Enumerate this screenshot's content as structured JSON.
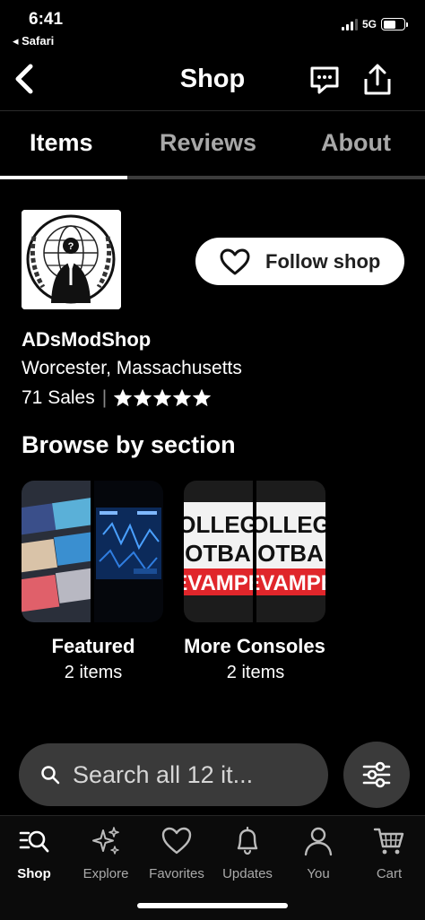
{
  "status_bar": {
    "time": "6:41",
    "back_app": "◂ Safari",
    "network": "5G"
  },
  "header": {
    "title": "Shop",
    "back_icon": "chevron-left-icon",
    "message_icon": "message-icon",
    "share_icon": "share-icon"
  },
  "tabs": [
    {
      "label": "Items",
      "active": true
    },
    {
      "label": "Reviews",
      "active": false
    },
    {
      "label": "About",
      "active": false
    }
  ],
  "shop": {
    "name": "ADsModShop",
    "location": "Worcester, Massachusetts",
    "sales": "71 Sales",
    "rating": 5,
    "follow_label": "Follow shop"
  },
  "browse": {
    "heading": "Browse by section",
    "sections": [
      {
        "name": "Featured",
        "count": "2 items"
      },
      {
        "name": "More Consoles",
        "count": "2 items"
      }
    ],
    "thumb_text": {
      "line1": "OLLEG",
      "line2": "OTBA",
      "line3": "EVAMPE"
    }
  },
  "search": {
    "placeholder": "Search all 12 it..."
  },
  "nav": [
    {
      "label": "Shop",
      "icon": "shop-search-icon",
      "active": true
    },
    {
      "label": "Explore",
      "icon": "sparkle-icon",
      "active": false
    },
    {
      "label": "Favorites",
      "icon": "heart-icon",
      "active": false
    },
    {
      "label": "Updates",
      "icon": "bell-icon",
      "active": false
    },
    {
      "label": "You",
      "icon": "user-icon",
      "active": false
    },
    {
      "label": "Cart",
      "icon": "cart-icon",
      "active": false
    }
  ],
  "colors": {
    "background": "#000000",
    "accent": "#ffffff",
    "search_bg": "#3a3a3a",
    "inactive_text": "#a8a8a8",
    "red_banner": "#e0262b"
  }
}
